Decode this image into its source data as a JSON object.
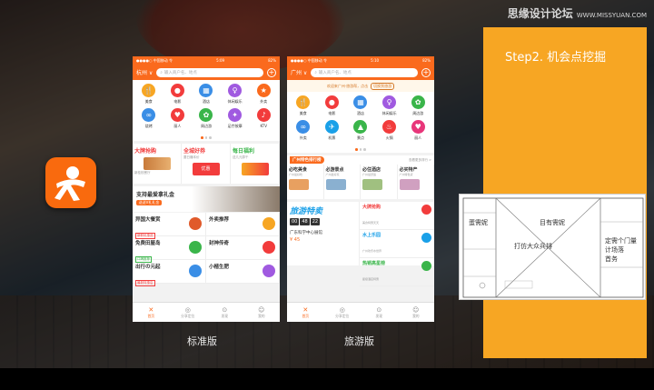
{
  "watermark": {
    "main": "思缘设计论坛",
    "sub": "WWW.MISSYUAN.COM"
  },
  "captions": {
    "standard": "标准版",
    "travel": "旅游版"
  },
  "panel": {
    "title": "Step2. 机会点挖掘"
  },
  "phone_standard": {
    "status": {
      "carrier": "●●●●○ 中国移动 令",
      "time": "5:09",
      "battery": "82%"
    },
    "city": "杭州 ∨",
    "search_placeholder": "输入商户名、地点",
    "icons": [
      {
        "label": "美食",
        "color": "#f7a623",
        "glyph": "🍴"
      },
      {
        "label": "电影",
        "color": "#f23c3c",
        "glyph": "●"
      },
      {
        "label": "酒店",
        "color": "#3a8ee6",
        "glyph": "▦"
      },
      {
        "label": "休闲娱乐",
        "color": "#a05ae0",
        "glyph": "♀"
      },
      {
        "label": "外卖",
        "color": "#fa6a1d",
        "glyph": "★"
      },
      {
        "label": "烧烤",
        "color": "#3a8ee6",
        "glyph": "∞"
      },
      {
        "label": "丽人",
        "color": "#f23c3c",
        "glyph": "♥"
      },
      {
        "label": "周边游",
        "color": "#3ab54a",
        "glyph": "✿"
      },
      {
        "label": "足疗按摩",
        "color": "#a05ae0",
        "glyph": "✦"
      },
      {
        "label": "KTV",
        "color": "#f23c3c",
        "glyph": "♪"
      }
    ],
    "promos": [
      {
        "title": "大牌抢购",
        "sub": "新桂枝餐厅"
      },
      {
        "title": "全城好券",
        "sub": "要日赚本价"
      },
      {
        "title": "每日福利",
        "sub": "送几元算千"
      }
    ],
    "promo_badge": "优惠",
    "banner": {
      "title": "支持最爱拿礼金",
      "tag": "送送V礼礼金"
    },
    "deals": [
      {
        "title": "异国大餐赏",
        "tag": "新鲜优惠品"
      },
      {
        "title": "外卖推荐",
        "tag": ""
      },
      {
        "title": "免费田屋岛",
        "tag": "口碑推荐"
      },
      {
        "title": "封神传奇",
        "tag": ""
      },
      {
        "title": "出行の元起",
        "tag": "最新特惠店"
      },
      {
        "title": "小楷生肥",
        "tag": ""
      }
    ],
    "tabs": [
      "首页",
      "分享定位",
      "发现",
      "我的"
    ]
  },
  "phone_travel": {
    "status": {
      "carrier": "●●●●○ 中国移动 令",
      "time": "5:10",
      "battery": "82%"
    },
    "city": "广州 ∨",
    "search_placeholder": "输入商户名、地点",
    "notice": "欢迎来广州·旅游帮，点击",
    "notice_button": "切换到旅游",
    "icons": [
      {
        "label": "美食",
        "color": "#f7a623",
        "glyph": "🍴"
      },
      {
        "label": "电影",
        "color": "#f23c3c",
        "glyph": "●"
      },
      {
        "label": "酒店",
        "color": "#3a8ee6",
        "glyph": "▦"
      },
      {
        "label": "休闲娱乐",
        "color": "#a05ae0",
        "glyph": "♀"
      },
      {
        "label": "周边游",
        "color": "#3ab54a",
        "glyph": "✿"
      },
      {
        "label": "外卖",
        "color": "#3a8ee6",
        "glyph": "∞"
      },
      {
        "label": "机票",
        "color": "#1aa0e8",
        "glyph": "✈"
      },
      {
        "label": "景点",
        "color": "#3ab54a",
        "glyph": "▲"
      },
      {
        "label": "火锅",
        "color": "#f23c3c",
        "glyph": "♨"
      },
      {
        "label": "丽人",
        "color": "#e8367a",
        "glyph": "♥"
      }
    ],
    "rank_title": "广州特色排行榜",
    "rank_more": "查看更多排行 >",
    "ranks": [
      {
        "title": "必吃美食",
        "sub": "广州最好吃"
      },
      {
        "title": "必游景点",
        "sub": "广州最好玩"
      },
      {
        "title": "必住酒店",
        "sub": "广州最舒适"
      },
      {
        "title": "必买特产",
        "sub": "广州特色货"
      }
    ],
    "sale": {
      "title": "旅游特卖",
      "timer": [
        "00",
        "48",
        "22"
      ],
      "place": "广东科学中心展馆",
      "price": "¥ 45"
    },
    "sale_items": [
      {
        "title": "大牌抢购",
        "sub": "美食特惠天天"
      },
      {
        "title": "水上乐园",
        "sub": "广州欢乐水世界"
      },
      {
        "title": "热销高星榜",
        "sub": "星级酒店特惠"
      }
    ],
    "tabs": [
      "首页",
      "分享定位",
      "发现",
      "我的"
    ]
  },
  "sketch_notes": {
    "left": "蛋需妮",
    "center_top": "目有需妮",
    "center": "打仿大众兵排",
    "right": "定需个门量\n计场落\n首务"
  },
  "colors": {
    "orange": "#fa6a1d",
    "panel": "#f7a623"
  }
}
